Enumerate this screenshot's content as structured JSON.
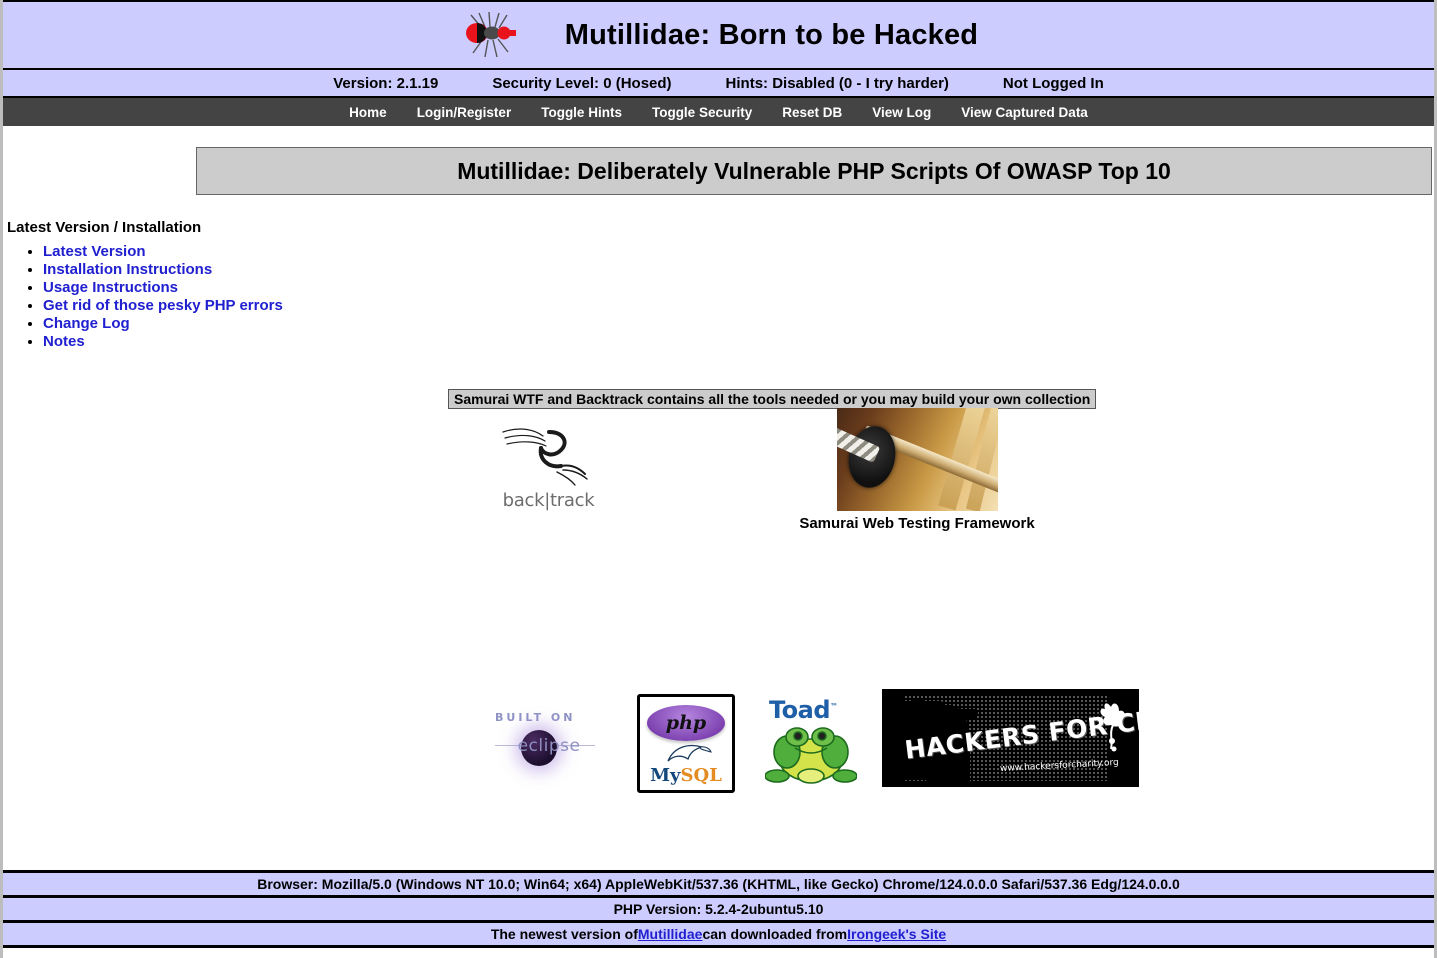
{
  "header": {
    "logo_icon": "ant-bug-icon",
    "title": "Mutillidae: Born to be Hacked"
  },
  "status_bar": {
    "version": "Version: 2.1.19",
    "security_level": "Security Level: 0 (Hosed)",
    "hints": "Hints: Disabled (0 - I try harder)",
    "login_state": "Not Logged In"
  },
  "nav": {
    "items": [
      {
        "label": "Home"
      },
      {
        "label": "Login/Register"
      },
      {
        "label": "Toggle Hints"
      },
      {
        "label": "Toggle Security"
      },
      {
        "label": "Reset DB"
      },
      {
        "label": "View Log"
      },
      {
        "label": "View Captured Data"
      }
    ]
  },
  "main": {
    "page_banner": "Mutillidae: Deliberately Vulnerable PHP Scripts Of OWASP Top 10",
    "section_heading": "Latest Version / Installation",
    "links": [
      {
        "label": "Latest Version"
      },
      {
        "label": "Installation Instructions"
      },
      {
        "label": "Usage Instructions"
      },
      {
        "label": "Get rid of those pesky PHP errors"
      },
      {
        "label": "Change Log"
      },
      {
        "label": "Notes"
      }
    ],
    "tools_caption": "Samurai WTF and Backtrack contains all the tools needed or you may build your own collection",
    "tools": {
      "backtrack": {
        "icon": "backtrack-logo-icon",
        "wordmark": "back|track"
      },
      "samurai": {
        "icon": "samurai-sword-photo",
        "caption": "Samurai Web Testing Framework"
      },
      "eclipse": {
        "icon": "eclipse-logo-icon",
        "top_text": "BUILT ON",
        "wordmark": "eclipse"
      },
      "php_mysql": {
        "icon": "php-mysql-logo-icon",
        "php_word": "php",
        "mysql_my": "My",
        "mysql_sql": "SQL"
      },
      "toad": {
        "icon": "toad-frog-logo-icon",
        "wordmark": "Toad",
        "tm": "™"
      },
      "hackers_for_charity": {
        "icon": "hackers-for-charity-banner-icon",
        "headline": "HACKERS FOR CHARITY",
        "url": "www.hackersforcharity.org"
      }
    }
  },
  "footer": {
    "browser": "Browser: Mozilla/5.0 (Windows NT 10.0; Win64; x64) AppleWebKit/537.36 (KHTML, like Gecko) Chrome/124.0.0.0 Safari/537.36 Edg/124.0.0.0",
    "php_version": "PHP Version: 5.2.4-2ubuntu5.10",
    "newest_prefix": "The newest version of ",
    "newest_link1": "Mutillidae",
    "newest_middle": " can downloaded from ",
    "newest_link2": "Irongeek's Site"
  },
  "colors": {
    "band_lavender": "#CCCCFF",
    "nav_dark": "#444444",
    "banner_gray": "#CCCCCC",
    "link_blue": "#2020D0"
  }
}
